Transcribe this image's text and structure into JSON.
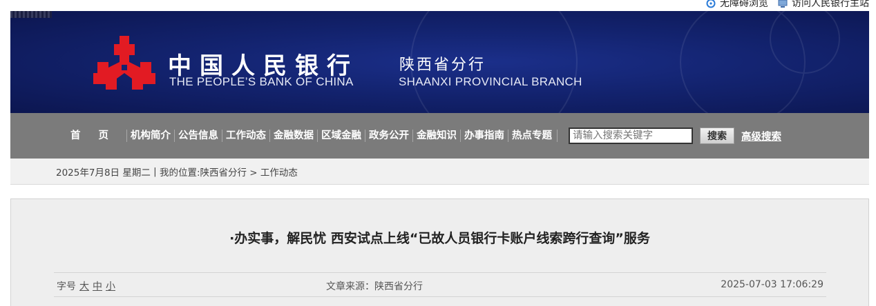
{
  "top_links": {
    "accessibility": "无障碍浏览",
    "visit_main": "访问人民银行主站"
  },
  "banner": {
    "title_cn": "中国人民银行",
    "title_en": "THE PEOPLE’S BANK OF CHINA",
    "branch_cn": "陕西省分行",
    "branch_en": "SHAANXI PROVINCIAL BRANCH"
  },
  "nav": {
    "items": [
      {
        "label": "首页"
      },
      {
        "label": "机构简介"
      },
      {
        "label": "公告信息"
      },
      {
        "label": "工作动态"
      },
      {
        "label": "金融数据"
      },
      {
        "label": "区域金融"
      },
      {
        "label": "政务公开"
      },
      {
        "label": "金融知识"
      },
      {
        "label": "办事指南"
      },
      {
        "label": "热点专题"
      }
    ],
    "search_placeholder": "请输入搜索关键字",
    "search_button": "搜索",
    "advanced_search": "高级搜索"
  },
  "crumb": {
    "date": "2025年7月8日 星期二",
    "separator": " | ",
    "location": "我的位置:陕西省分行 > 工作动态"
  },
  "article": {
    "title": "·办实事，解民忧 西安试点上线“已故人员银行卡账户线索跨行查询”服务",
    "font_size_label": "字号",
    "font_sizes": [
      "大",
      "中",
      "小"
    ],
    "source": "文章来源：陕西省分行",
    "date": "2025-07-03 17:06:29"
  },
  "colors": {
    "banner_blue": "#13236f",
    "nav_gray": "#7b7b7b",
    "logo_red": "#e21b23"
  }
}
